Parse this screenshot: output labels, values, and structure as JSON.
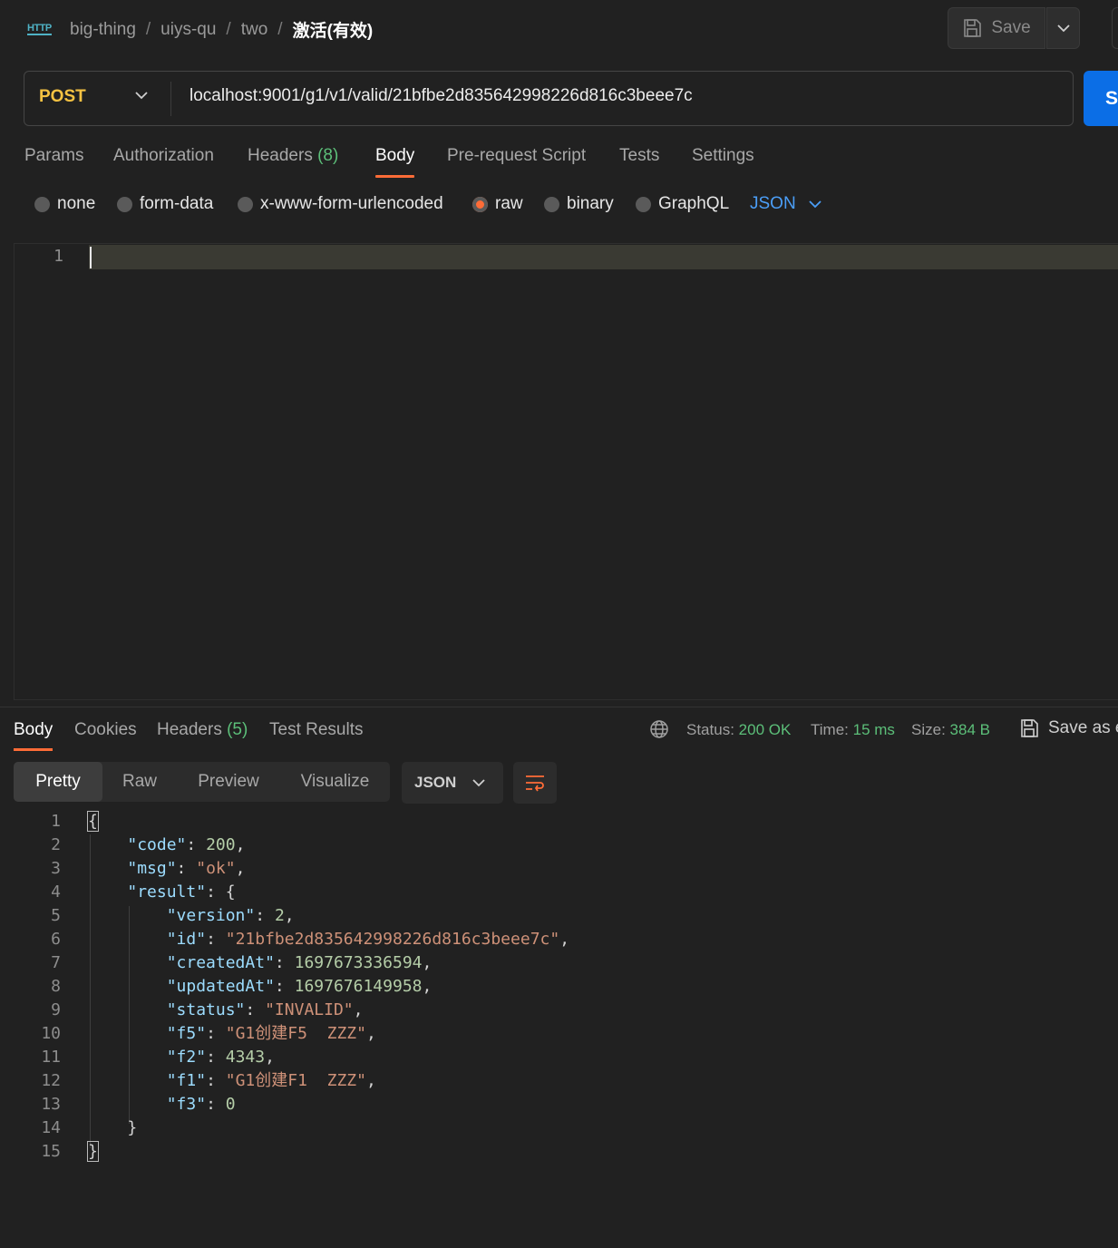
{
  "breadcrumb": {
    "icon_text": "HTTP",
    "items": [
      "big-thing",
      "uiys-qu",
      "two"
    ],
    "separator": "/",
    "current": "激活(有效)"
  },
  "header": {
    "save_label": "Save"
  },
  "request": {
    "method": "POST",
    "url": "localhost:9001/g1/v1/valid/21bfbe2d835642998226d816c3beee7c",
    "send_label": "S"
  },
  "request_tabs": {
    "params": "Params",
    "authorization": "Authorization",
    "headers": "Headers",
    "headers_count": "(8)",
    "body": "Body",
    "prerequest": "Pre-request Script",
    "tests": "Tests",
    "settings": "Settings"
  },
  "body_options": {
    "none": "none",
    "form_data": "form-data",
    "urlencoded": "x-www-form-urlencoded",
    "raw": "raw",
    "binary": "binary",
    "graphql": "GraphQL",
    "language": "JSON",
    "selected": "raw"
  },
  "editor": {
    "line_numbers": [
      "1"
    ]
  },
  "response_tabs": {
    "body": "Body",
    "cookies": "Cookies",
    "headers": "Headers",
    "headers_count": "(5)",
    "test_results": "Test Results"
  },
  "response_meta": {
    "status_label": "Status:",
    "status_value": "200 OK",
    "time_label": "Time:",
    "time_value": "15 ms",
    "size_label": "Size:",
    "size_value": "384 B",
    "save_as_label": "Save as e"
  },
  "view_modes": {
    "pretty": "Pretty",
    "raw": "Raw",
    "preview": "Preview",
    "visualize": "Visualize",
    "format": "JSON"
  },
  "response_body": {
    "line_numbers": [
      "1",
      "2",
      "3",
      "4",
      "5",
      "6",
      "7",
      "8",
      "9",
      "10",
      "11",
      "12",
      "13",
      "14",
      "15"
    ],
    "lines": {
      "l1": "{",
      "l2_key": "\"code\"",
      "l2_val": "200",
      "l3_key": "\"msg\"",
      "l3_val": "\"ok\"",
      "l4_key": "\"result\"",
      "l4_open": "{",
      "l5_key": "\"version\"",
      "l5_val": "2",
      "l6_key": "\"id\"",
      "l6_val": "\"21bfbe2d835642998226d816c3beee7c\"",
      "l7_key": "\"createdAt\"",
      "l7_val": "1697673336594",
      "l8_key": "\"updatedAt\"",
      "l8_val": "1697676149958",
      "l9_key": "\"status\"",
      "l9_val": "\"INVALID\"",
      "l10_key": "\"f5\"",
      "l10_val": "\"G1创建F5  ZZZ\"",
      "l11_key": "\"f2\"",
      "l11_val": "4343",
      "l12_key": "\"f1\"",
      "l12_val": "\"G1创建F1  ZZZ\"",
      "l13_key": "\"f3\"",
      "l13_val": "0",
      "l14": "}",
      "l15": "}"
    }
  },
  "colors": {
    "accent": "#ff6c37",
    "method": "#f5c242",
    "send": "#0b6ee6",
    "status_ok": "#5cbf79",
    "json_key": "#9cdcfe",
    "json_string": "#ce9178",
    "json_number": "#b5cea8"
  }
}
